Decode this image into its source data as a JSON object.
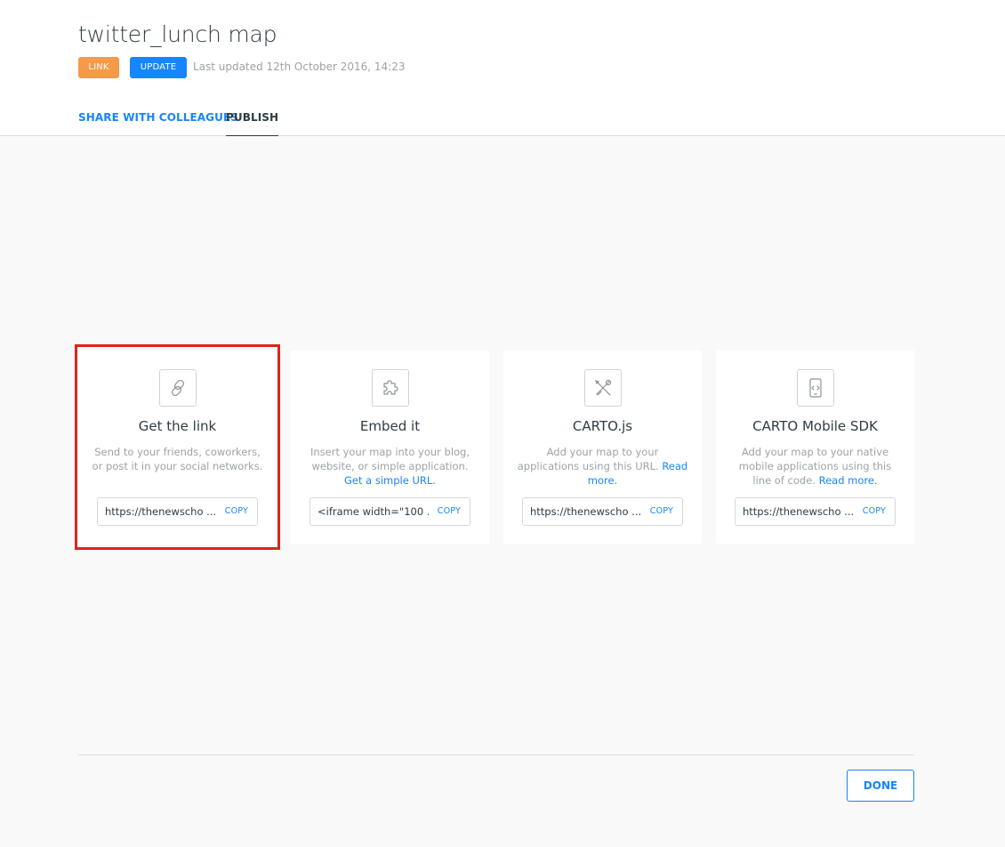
{
  "header": {
    "title": "twitter_lunch map",
    "link_badge": "LINK",
    "update_button": "UPDATE",
    "last_updated": "Last updated 12th October 2016, 14:23"
  },
  "tabs": [
    {
      "label": "SHARE WITH COLLEAGUES",
      "active": false
    },
    {
      "label": "PUBLISH",
      "active": true
    }
  ],
  "cards": [
    {
      "icon": "link-icon",
      "title": "Get the link",
      "description": "Send to your friends, coworkers, or post it in your social networks.",
      "link": "",
      "field_value": "https://thenewscho   ...",
      "copy_label": "COPY"
    },
    {
      "icon": "puzzle-icon",
      "title": "Embed it",
      "description": "Insert your map into your blog, website, or simple application.",
      "link": "Get a simple URL.",
      "field_value": "<iframe width=\"100 ...",
      "copy_label": "COPY"
    },
    {
      "icon": "tools-icon",
      "title": "CARTO.js",
      "description": "Add your map to your applications using this URL.",
      "link": "Read more.",
      "field_value": "https://thenewscho   ...",
      "copy_label": "COPY"
    },
    {
      "icon": "mobile-code-icon",
      "title": "CARTO Mobile SDK",
      "description": "Add your map to your native mobile applications using this line of code.",
      "link": "Read more.",
      "field_value": "https://thenewscho   ...",
      "copy_label": "COPY"
    }
  ],
  "footer": {
    "done_button": "DONE"
  },
  "colors": {
    "accent": "#1785fb",
    "badge_orange": "#f49a49",
    "highlight_red": "#d9261c"
  }
}
